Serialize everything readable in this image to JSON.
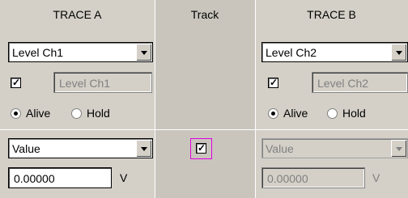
{
  "headers": {
    "trace_a": "TRACE A",
    "track": "Track",
    "trace_b": "TRACE B"
  },
  "trace_a": {
    "source_select": "Level Ch1",
    "label_field": "Level Ch1",
    "label_checked": true,
    "mode_alive": "Alive",
    "mode_hold": "Hold",
    "mode_selected": "Alive",
    "scale_select": "Value",
    "value_field": "0.00000",
    "unit": "V"
  },
  "track": {
    "checked": true
  },
  "trace_b": {
    "source_select": "Level Ch2",
    "label_field": "Level Ch2",
    "label_checked": true,
    "mode_alive": "Alive",
    "mode_hold": "Hold",
    "mode_selected": "Alive",
    "scale_select": "Value",
    "value_field": "0.00000",
    "unit": "V"
  },
  "icons": {
    "check": "✓",
    "dropdown": "chevron-down-icon"
  }
}
